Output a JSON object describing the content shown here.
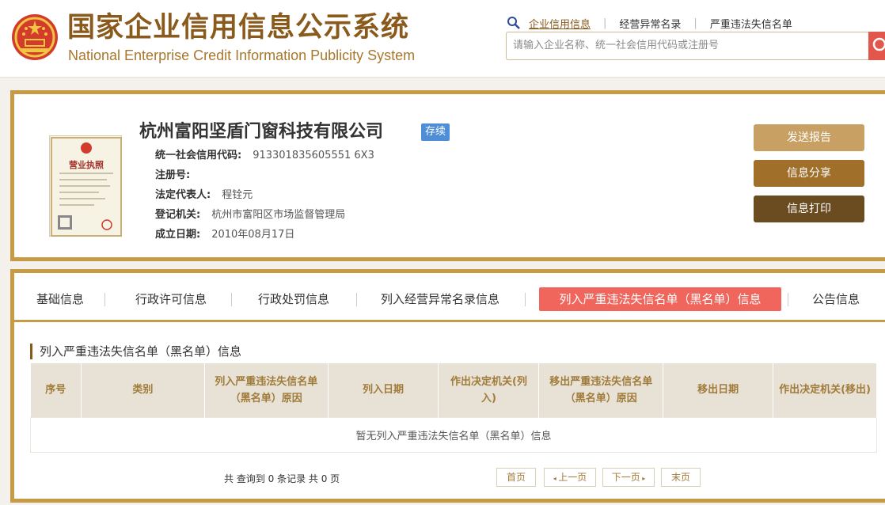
{
  "header": {
    "title": "国家企业信用信息公示系统",
    "subtitle": "National Enterprise Credit Information Publicity System",
    "links": [
      "企业信用信息",
      "经营异常名录",
      "严重违法失信名单"
    ],
    "search_placeholder": "请输入企业名称、统一社会信用代码或注册号"
  },
  "company": {
    "name": "杭州富阳坚盾门窗科技有限公司",
    "status": "存续",
    "fields": [
      {
        "label": "统一社会信用代码:",
        "value": "913301835605551 6X3"
      },
      {
        "label": "注册号:",
        "value": ""
      },
      {
        "label": "法定代表人:",
        "value": "程铨元"
      },
      {
        "label": "登记机关:",
        "value": "杭州市富阳区市场监督管理局"
      },
      {
        "label": "成立日期:",
        "value": "2010年08月17日"
      }
    ],
    "license_label": "营业执照",
    "actions": [
      "发送报告",
      "信息分享",
      "信息打印"
    ]
  },
  "tabs": [
    "基础信息",
    "行政许可信息",
    "行政处罚信息",
    "列入经营异常名录信息",
    "列入严重违法失信名单（黑名单）信息",
    "公告信息"
  ],
  "active_tab": 4,
  "section": {
    "title": "列入严重违法失信名单（黑名单）信息",
    "columns": [
      "序号",
      "类别",
      "列入严重违法失信名单（黑名单）原因",
      "列入日期",
      "作出决定机关(列入)",
      "移出严重违法失信名单（黑名单）原因",
      "移出日期",
      "作出决定机关(移出)"
    ],
    "empty_text": "暂无列入严重违法失信名单（黑名单）信息"
  },
  "pagination": {
    "summary": "共 查询到 0 条记录 共 0 页",
    "first": "首页",
    "prev": "上一页",
    "next": "下一页",
    "last": "末页"
  },
  "colors": {
    "accent": "#c79a46",
    "active_tab": "#f0665c",
    "status_badge": "#4f8ed6"
  }
}
